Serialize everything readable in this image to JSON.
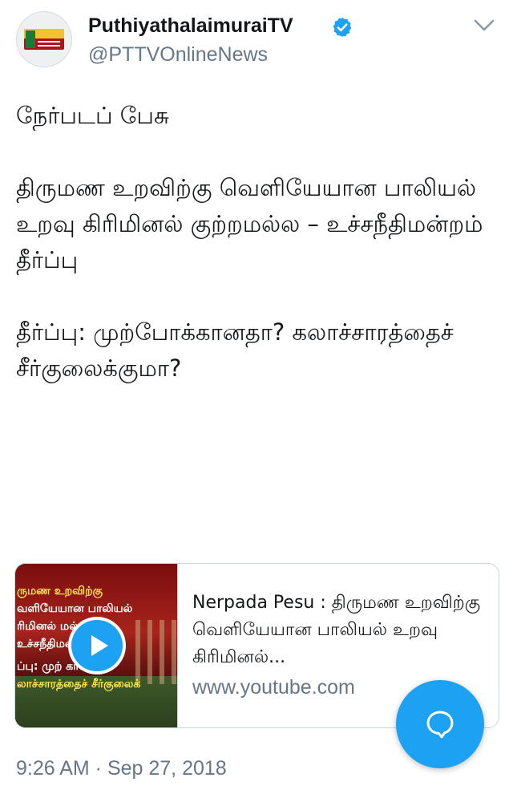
{
  "tweet": {
    "author": {
      "display_name": "PuthiyathalaimuraiTV",
      "handle": "@PTTVOnlineNews",
      "verified": true,
      "avatar_icon": "puthiya-thalaimurai-logo"
    },
    "menu_icon": "chevron-down-icon",
    "text": "நேர்படப் பேசு\n\nதிருமண உறவிற்கு வெளியேயான பாலியல் உறவு கிரிமினல் குற்றமல்ல – உச்சநீதிமன்றம் தீர்ப்பு\n\nதீர்ப்பு: முற்போக்கானதா? கலாச்சாரத்தைச் சீர்குலைக்குமா?",
    "card": {
      "title": "Nerpada Pesu : திருமண உறவிற்கு வெளியேயான பாலியல் உறவு கிரிமினல்...",
      "domain": "www.youtube.com",
      "thumbnail_lines": [
        "ருமண உறவிற்கு",
        "வளியேயான பாலியல்",
        "ரிமினல்          மல்ல",
        "உச்சநீதிமன்    பு",
        "ப்பு: முற்       கானதா?",
        "லாச்சாரத்தைச் சீர்குலைக்"
      ],
      "play_icon": "play-icon"
    },
    "timestamp": "9:26 AM · Sep 27, 2018"
  },
  "fab": {
    "icon": "reply-bubble-icon"
  },
  "colors": {
    "accent": "#1da1f2",
    "text": "#14171a",
    "secondary": "#657786",
    "border": "#ccd6dd"
  }
}
